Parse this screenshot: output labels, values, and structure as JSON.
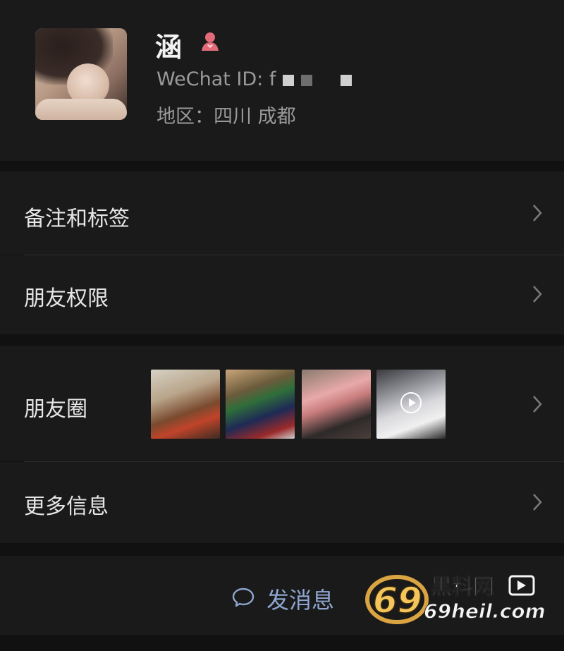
{
  "profile": {
    "name": "涵",
    "wechat_id_label": "WeChat ID: f",
    "region": "地区：四川 成都",
    "gender_icon": "female-icon",
    "gender_color": "#e26b7a"
  },
  "menu": {
    "remarks_tags": "备注和标签",
    "friend_permissions": "朋友权限",
    "moments": "朋友圈",
    "more_info": "更多信息"
  },
  "moments_thumbnails": [
    {
      "name": "moments-thumb-1",
      "kind": "photo"
    },
    {
      "name": "moments-thumb-2",
      "kind": "photo"
    },
    {
      "name": "moments-thumb-3",
      "kind": "photo"
    },
    {
      "name": "moments-thumb-4",
      "kind": "video"
    }
  ],
  "actions": {
    "send_message": "发消息",
    "send_icon": "chat-bubble-icon",
    "accent": "#8ea6cf"
  },
  "watermark": {
    "line1": "69黑料网",
    "line2": "69heil.com"
  }
}
